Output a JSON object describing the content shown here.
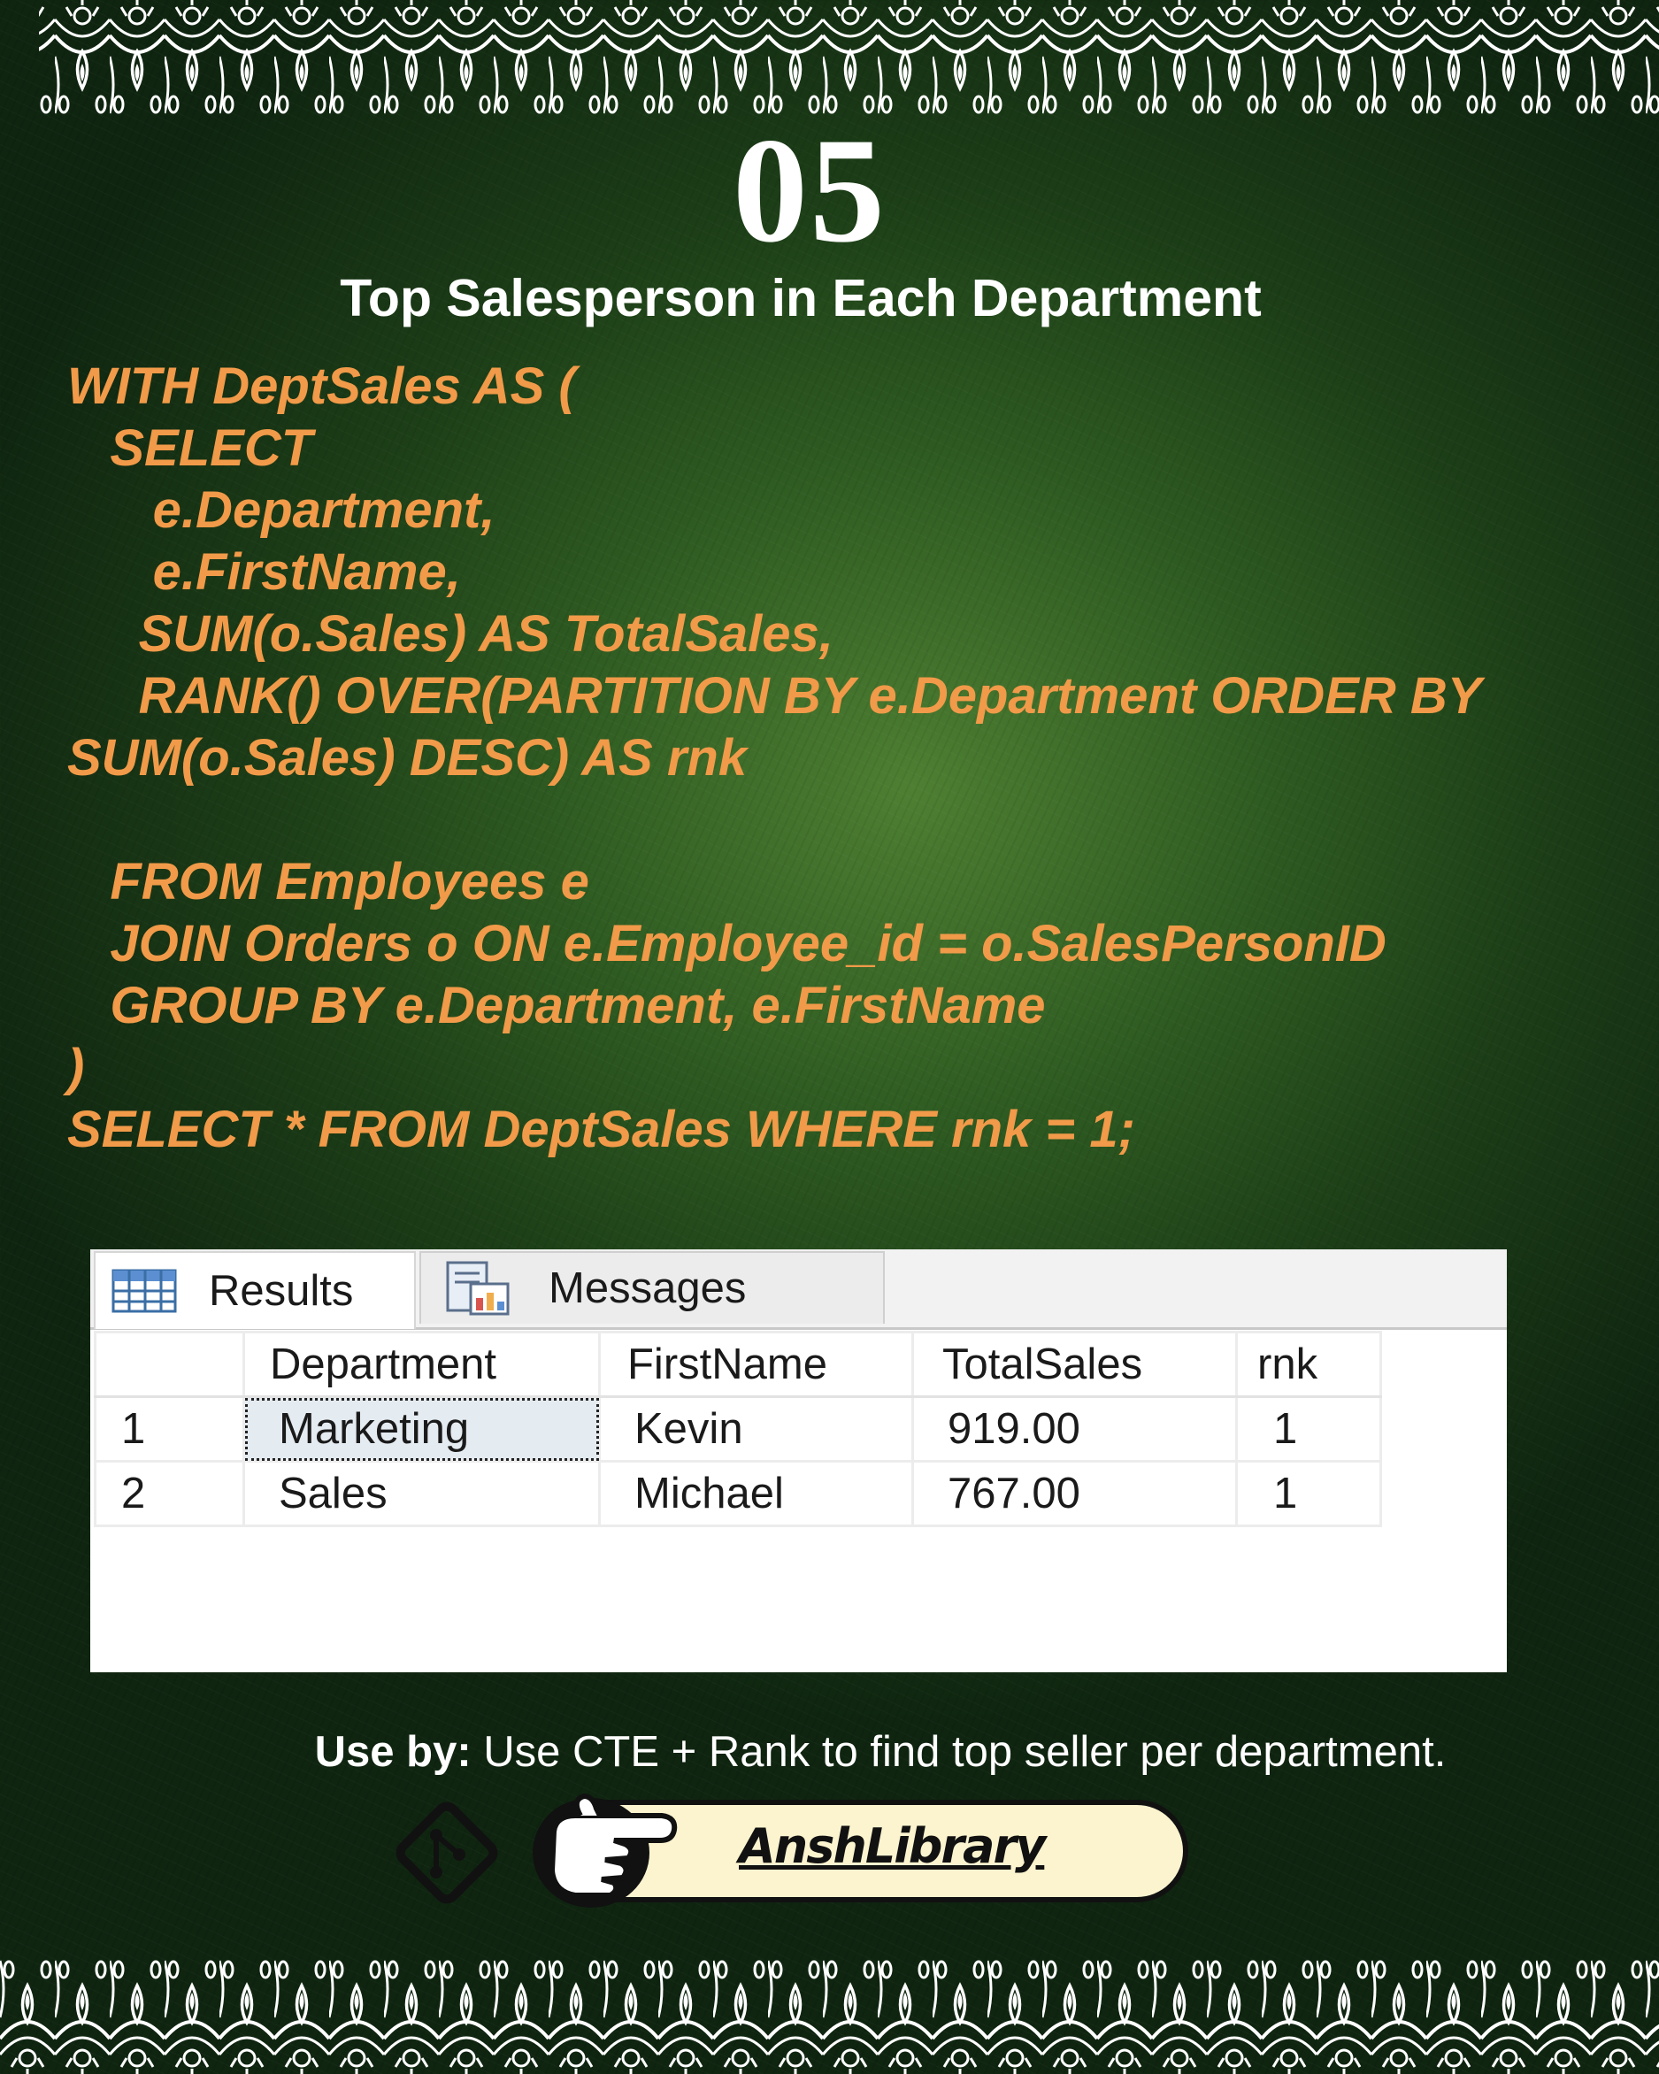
{
  "slide": {
    "number": "05",
    "title": "Top Salesperson in Each Department"
  },
  "code_lines": [
    "WITH DeptSales AS (",
    "   SELECT",
    "      e.Department,",
    "      e.FirstName,",
    "     SUM(o.Sales) AS TotalSales,",
    "     RANK() OVER(PARTITION BY e.Department ORDER BY",
    "SUM(o.Sales) DESC) AS rnk",
    "",
    "   FROM Employees e",
    "   JOIN Orders o ON e.Employee_id = o.SalesPersonID",
    "   GROUP BY e.Department, e.FirstName",
    ")",
    "SELECT * FROM DeptSales WHERE rnk = 1;"
  ],
  "results_panel": {
    "tabs": [
      {
        "label": "Results",
        "icon": "grid-icon",
        "active": true
      },
      {
        "label": "Messages",
        "icon": "messages-icon",
        "active": false
      }
    ],
    "columns": [
      "",
      "Department",
      "FirstName",
      "TotalSales",
      "rnk"
    ],
    "rows": [
      [
        "1",
        "Marketing",
        "Kevin",
        "919.00",
        "1"
      ],
      [
        "2",
        "Sales",
        "Michael",
        "767.00",
        "1"
      ]
    ],
    "selected_cell": {
      "row": 0,
      "column": "Department"
    }
  },
  "use_by": {
    "label": "Use by:",
    "text": " Use CTE + Rank to find top seller per department."
  },
  "footer": {
    "link_text": "AnshLibrary",
    "icons": [
      "git-icon",
      "pointing-hand-icon"
    ]
  },
  "colors": {
    "background": "#2f5c22",
    "code_text": "#f19a49",
    "title_text": "#ffffff",
    "pill_fill": "#fbf4cf"
  }
}
